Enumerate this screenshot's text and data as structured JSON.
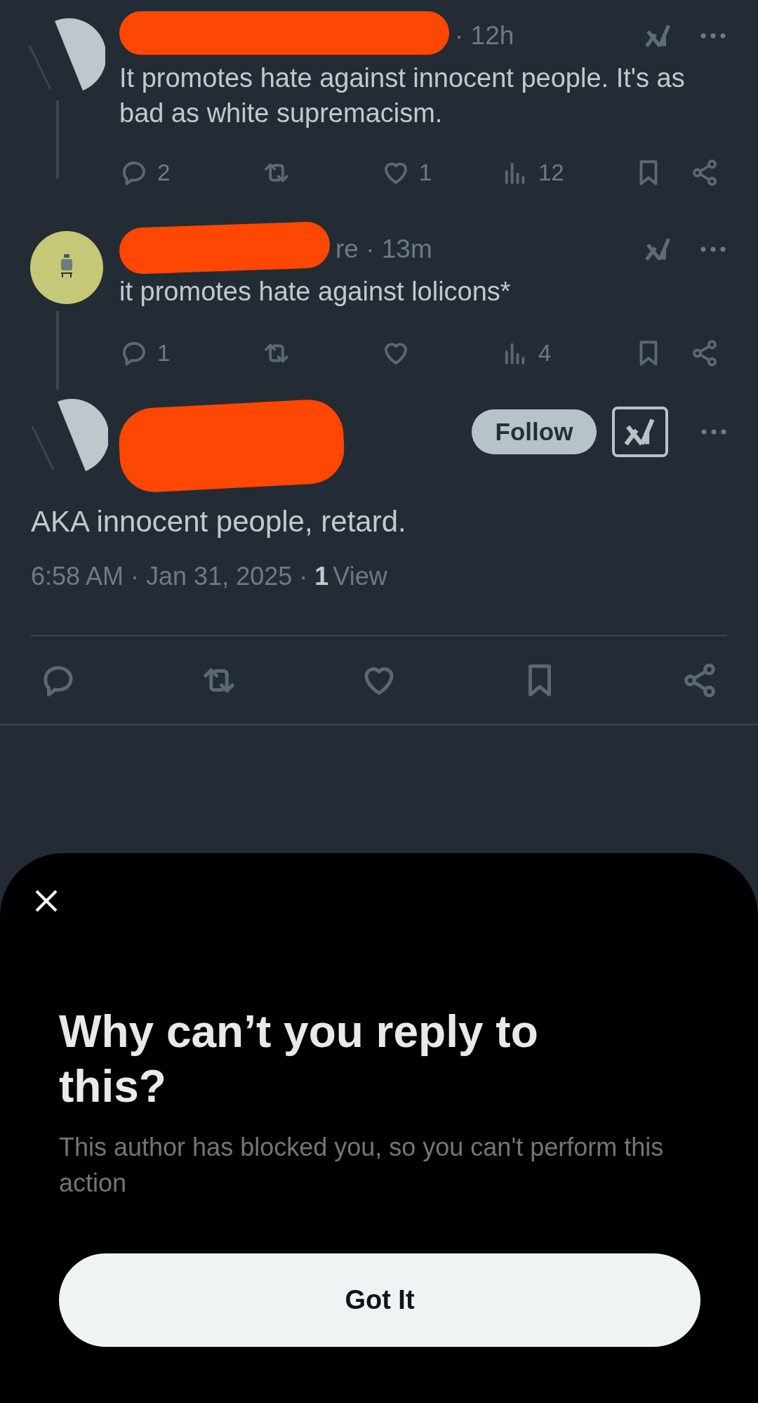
{
  "replies": [
    {
      "avatar": {
        "kind": "split"
      },
      "meta": "· 12h",
      "text": "It promotes hate against innocent people. It's as bad as white supremacism.",
      "actions": [
        {
          "kind": "reply",
          "count": "2"
        },
        {
          "kind": "repost"
        },
        {
          "kind": "like",
          "count": "1"
        },
        {
          "kind": "views",
          "count": "12"
        },
        {
          "kind": "bookmark"
        },
        {
          "kind": "share"
        }
      ]
    },
    {
      "avatar": {
        "kind": "figure"
      },
      "meta": "re · 13m",
      "text": "it promotes hate against lolicons*",
      "actions": [
        {
          "kind": "reply",
          "count": "1"
        },
        {
          "kind": "repost"
        },
        {
          "kind": "like"
        },
        {
          "kind": "views",
          "count": "4"
        },
        {
          "kind": "bookmark"
        },
        {
          "kind": "share"
        }
      ]
    }
  ],
  "tweet": {
    "avatar": {
      "kind": "split"
    },
    "follow": "Follow",
    "text": "AKA innocent people, retard.",
    "time": "6:58 AM · Jan 31, 2025 ·",
    "views_count": "1",
    "views_label": "View",
    "actions": [
      {
        "kind": "reply"
      },
      {
        "kind": "repost"
      },
      {
        "kind": "like"
      },
      {
        "kind": "bookmark"
      },
      {
        "kind": "share"
      }
    ]
  },
  "sheet": {
    "title": "Why can’t you reply to this?",
    "body": "This author has blocked you, so you can't perform this action",
    "button": "Got It"
  }
}
